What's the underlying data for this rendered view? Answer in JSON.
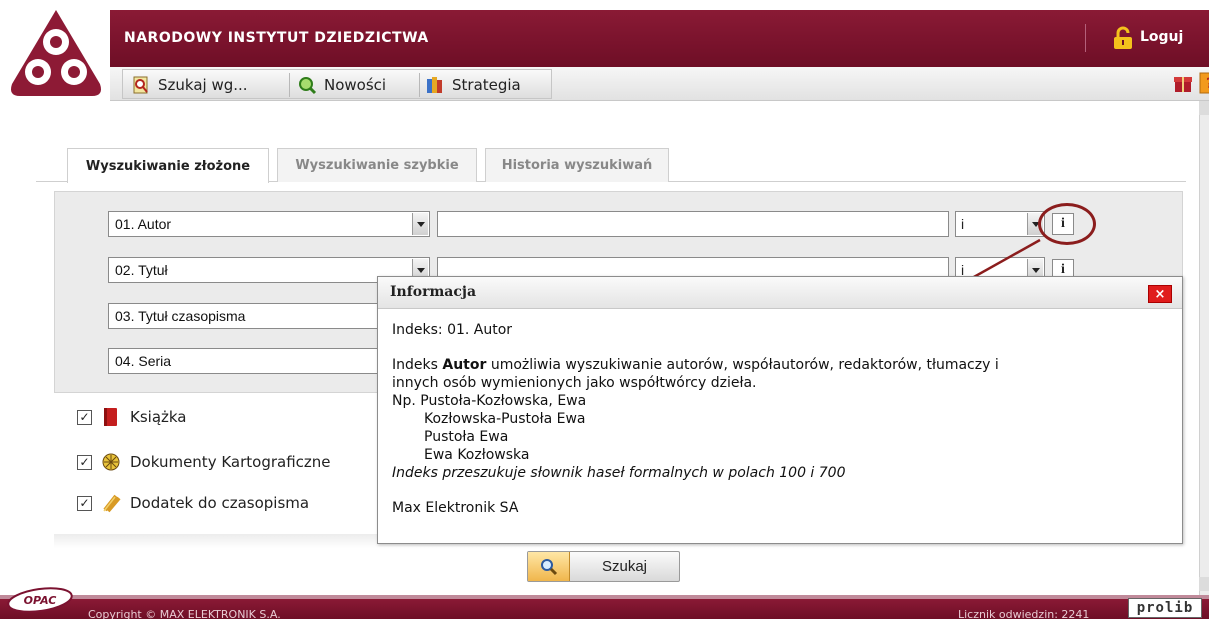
{
  "header": {
    "site_title": "NARODOWY INSTYTUT DZIEDZICTWA",
    "login_label": "Loguj",
    "brand_color": "#7b1230"
  },
  "menu": {
    "items": [
      {
        "label": "Szukaj wg...",
        "icon": "search-form-icon"
      },
      {
        "label": "Nowości",
        "icon": "news-icon"
      },
      {
        "label": "Strategia",
        "icon": "strategy-icon"
      }
    ],
    "right_icons": [
      "gift-icon",
      "help-icon"
    ]
  },
  "tabs": [
    {
      "label": "Wyszukiwanie złożone",
      "active": true
    },
    {
      "label": "Wyszukiwanie szybkie",
      "active": false
    },
    {
      "label": "Historia wyszukiwań",
      "active": false
    }
  ],
  "search_rows": [
    {
      "index": "01. Autor",
      "value": "",
      "operator": "i",
      "info": "i"
    },
    {
      "index": "02. Tytuł",
      "value": "",
      "operator": "i",
      "info": "i"
    },
    {
      "index": "03. Tytuł czasopisma"
    },
    {
      "index": "04. Seria"
    }
  ],
  "doc_types": [
    {
      "label": "Książka",
      "checked": true,
      "icon": "book-icon"
    },
    {
      "label": "Dokumenty Kartograficzne",
      "checked": true,
      "icon": "map-icon"
    },
    {
      "label": "Dodatek do czasopisma",
      "checked": true,
      "icon": "attachment-icon"
    }
  ],
  "search_button_label": "Szukaj",
  "popup": {
    "title": "Informacja",
    "close_label": "×",
    "index_line": "Indeks: 01. Autor",
    "desc_prefix": "Indeks ",
    "desc_bold": "Autor",
    "desc_rest": " umożliwia wyszukiwanie autorów, współautorów, redaktorów, tłumaczy i",
    "desc_line2": "innych osób wymienionych jako współtwórcy dzieła.",
    "example_intro": "Np. Pustoła-Kozłowska, Ewa",
    "examples": [
      "Kozłowska-Pustoła Ewa",
      "Pustoła Ewa",
      "Ewa Kozłowska"
    ],
    "note": "Indeks przeszukuje słownik haseł formalnych w polach 100 i 700",
    "company": "Max Elektronik SA"
  },
  "footer": {
    "copyright": "Copyright © MAX ELEKTRONIK S.A.",
    "counter": "Licznik odwiedzin: 2241",
    "opac_logo": "OPAC",
    "prolib_logo": "prolib"
  }
}
